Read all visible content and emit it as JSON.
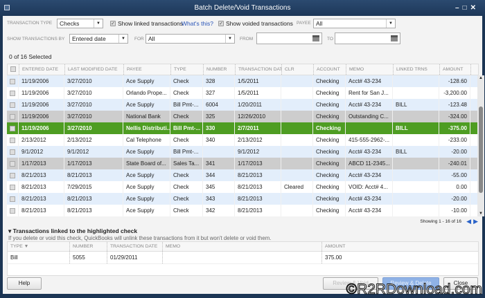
{
  "window": {
    "title": "Batch Delete/Void Transactions"
  },
  "filters": {
    "transaction_type_label": "TRANSACTION TYPE",
    "transaction_type": "Checks",
    "show_linked": "Show linked transactions",
    "whats_this": "What's this?",
    "show_voided": "Show voided transactions",
    "payee_label": "PAYEE",
    "payee": "All",
    "show_by_label": "SHOW TRANSACTIONS BY",
    "show_by": "Entered date",
    "for_label": "FOR",
    "for": "All",
    "from_label": "FROM",
    "from": "",
    "to_label": "TO",
    "to": ""
  },
  "selected_count": "0 of 16 Selected",
  "columns": [
    "ENTERED DATE",
    "LAST MODIFIED DATE",
    "PAYEE",
    "TYPE",
    "NUMBER",
    "TRANSACTION DATE",
    "CLR",
    "ACCOUNT",
    "MEMO",
    "LINKED TRNS",
    "AMOUNT"
  ],
  "rows": [
    [
      "11/19/2006",
      "3/27/2010",
      "Ace Supply",
      "Check",
      "328",
      "1/5/2011",
      "",
      "Checking",
      "Acct# 43-234",
      "",
      "-128.60"
    ],
    [
      "11/19/2006",
      "3/27/2010",
      "Orlando Prope...",
      "Check",
      "327",
      "1/5/2011",
      "",
      "Checking",
      "Rent for San J...",
      "",
      "-3,200.00"
    ],
    [
      "11/19/2006",
      "3/27/2010",
      "Ace Supply",
      "Bill Pmt-...",
      "6004",
      "1/20/2011",
      "",
      "Checking",
      "Acct# 43-234",
      "BILL",
      "-123.48"
    ],
    [
      "11/19/2006",
      "3/27/2010",
      "National Bank",
      "Check",
      "325",
      "12/26/2010",
      "",
      "Checking",
      "Outstanding C...",
      "",
      "-324.00"
    ],
    [
      "11/19/2006",
      "3/27/2010",
      "Nellis Distributi...",
      "Bill Pmt-...",
      "330",
      "2/7/2011",
      "",
      "Checking",
      "",
      "BILL",
      "-375.00"
    ],
    [
      "2/13/2012",
      "2/13/2012",
      "Cal Telephone",
      "Check",
      "340",
      "2/13/2012",
      "",
      "Checking",
      "415-555-2962-...",
      "",
      "-233.00"
    ],
    [
      "9/1/2012",
      "9/1/2012",
      "Ace Supply",
      "Bill Pmt-...",
      "",
      "9/1/2012",
      "",
      "Checking",
      "Acct# 43-234",
      "BILL",
      "-20.00"
    ],
    [
      "1/17/2013",
      "1/17/2013",
      "State Board of...",
      "Sales Ta...",
      "341",
      "1/17/2013",
      "",
      "Checking",
      "ABCD 11-2345...",
      "",
      "-240.01"
    ],
    [
      "8/21/2013",
      "8/21/2013",
      "Ace Supply",
      "Check",
      "344",
      "8/21/2013",
      "",
      "Checking",
      "Acct# 43-234",
      "",
      "-55.00"
    ],
    [
      "8/21/2013",
      "7/29/2015",
      "Ace Supply",
      "Check",
      "345",
      "8/21/2013",
      "Cleared",
      "Checking",
      "VOID: Acct# 4...",
      "",
      "0.00"
    ],
    [
      "8/21/2013",
      "8/21/2013",
      "Ace Supply",
      "Check",
      "343",
      "8/21/2013",
      "",
      "Checking",
      "Acct# 43-234",
      "",
      "-20.00"
    ],
    [
      "8/21/2013",
      "8/21/2013",
      "Ace Supply",
      "Check",
      "342",
      "8/21/2013",
      "",
      "Checking",
      "Acct# 43-234",
      "",
      "-10.00"
    ]
  ],
  "row_styles": [
    "even",
    "odd",
    "even",
    "gray",
    "sel",
    "odd",
    "even",
    "gray",
    "even",
    "odd",
    "even",
    "odd"
  ],
  "paging": "Showing 1 - 16 of 16",
  "linked": {
    "title": "Transactions linked to the highlighted check",
    "hint": "If you delete or void this check, QuickBooks will unlink these transactions from it but won't delete or void them.",
    "columns": [
      "TYPE ▼",
      "NUMBER",
      "TRANSACTION DATE",
      "MEMO",
      "AMOUNT"
    ],
    "rows": [
      [
        "Bill",
        "5055",
        "01/29/2011",
        "",
        "375.00"
      ]
    ]
  },
  "buttons": {
    "help": "Help",
    "review_void": "Review & Void",
    "review_delete": "Review & Delete",
    "close": "Close"
  },
  "colors": {
    "selected_row": "#4e9d22",
    "title_bar": "#1d3758",
    "alt_row": "#e3eefb",
    "voided_row": "#cdcdcd"
  },
  "watermark": "©R2RDownload.com"
}
